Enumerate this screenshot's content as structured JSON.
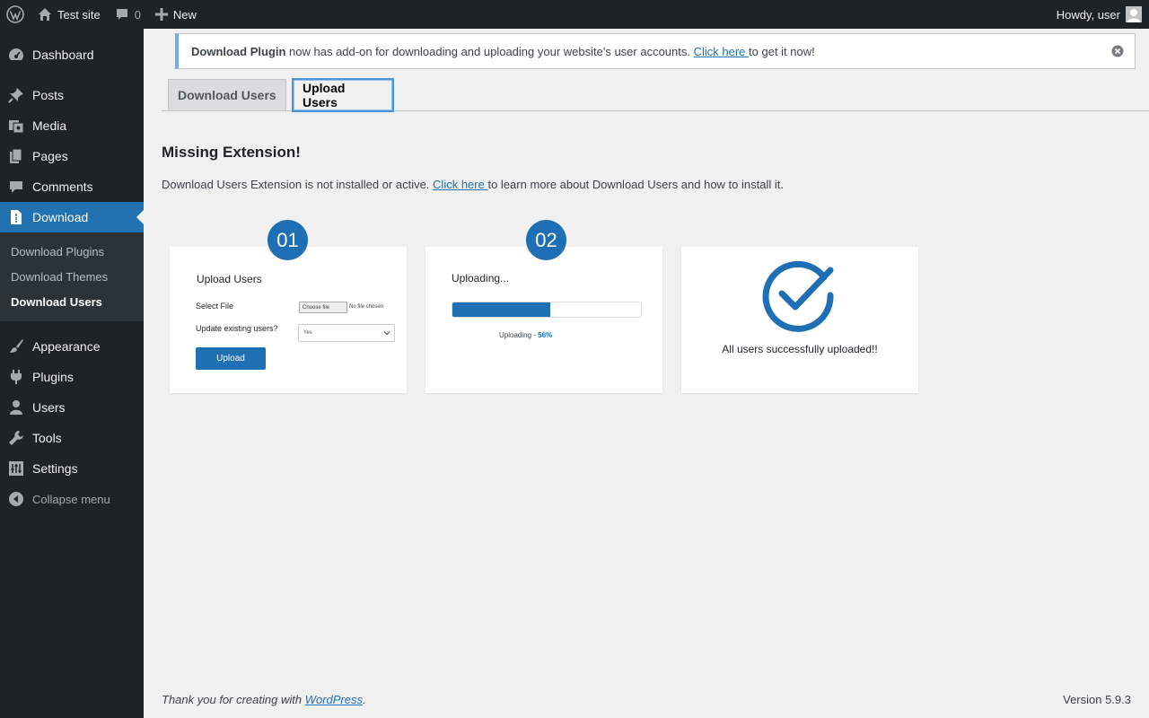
{
  "adminbar": {
    "site_name": "Test site",
    "comments_count": "0",
    "new_label": "New",
    "howdy": "Howdy, user"
  },
  "sidebar": {
    "items": [
      {
        "label": "Dashboard",
        "icon": "dashboard-icon"
      },
      {
        "label": "Posts",
        "icon": "pin-icon"
      },
      {
        "label": "Media",
        "icon": "media-icon"
      },
      {
        "label": "Pages",
        "icon": "pages-icon"
      },
      {
        "label": "Comments",
        "icon": "comment-icon"
      },
      {
        "label": "Download",
        "icon": "download-file-icon"
      },
      {
        "label": "Appearance",
        "icon": "brush-icon"
      },
      {
        "label": "Plugins",
        "icon": "plug-icon"
      },
      {
        "label": "Users",
        "icon": "user-icon"
      },
      {
        "label": "Tools",
        "icon": "wrench-icon"
      },
      {
        "label": "Settings",
        "icon": "sliders-icon"
      }
    ],
    "submenu": [
      "Download Plugins",
      "Download Themes",
      "Download Users"
    ],
    "collapse_label": "Collapse menu"
  },
  "notice": {
    "bold": "Download Plugin",
    "text": " now has add-on for downloading and uploading your website's user accounts. ",
    "link": "Click here ",
    "after": "to get it now!"
  },
  "tabs": [
    "Download Users",
    "Upload Users"
  ],
  "main": {
    "heading": "Missing Extension!",
    "para_before": "Download Users Extension is not installed or active. ",
    "para_link": "Click here ",
    "para_after": "to learn more about Download Users and how to install it."
  },
  "cards": {
    "step1": "01",
    "step2": "02",
    "c1_title": "Upload Users",
    "c1_select_file": "Select File",
    "c1_choose_file": "Choose file",
    "c1_no_file": "No file chosen",
    "c1_update_label": "Update existing users?",
    "c1_select_value": "Yes",
    "c1_upload": "Upload",
    "c2_title": "Uploading...",
    "c2_status": "Uploading - ",
    "c2_pct": "56%",
    "c2_progress": 0.52,
    "c3_msg": "All users successfully uploaded!!"
  },
  "footer": {
    "thanks_before": "Thank you for creating with ",
    "thanks_link": "WordPress",
    "thanks_after": ".",
    "version": "Version 5.9.3"
  },
  "colors": {
    "admin_dark": "#1d2327",
    "accent": "#2271b1",
    "step_blue": "#1e6fb3"
  }
}
